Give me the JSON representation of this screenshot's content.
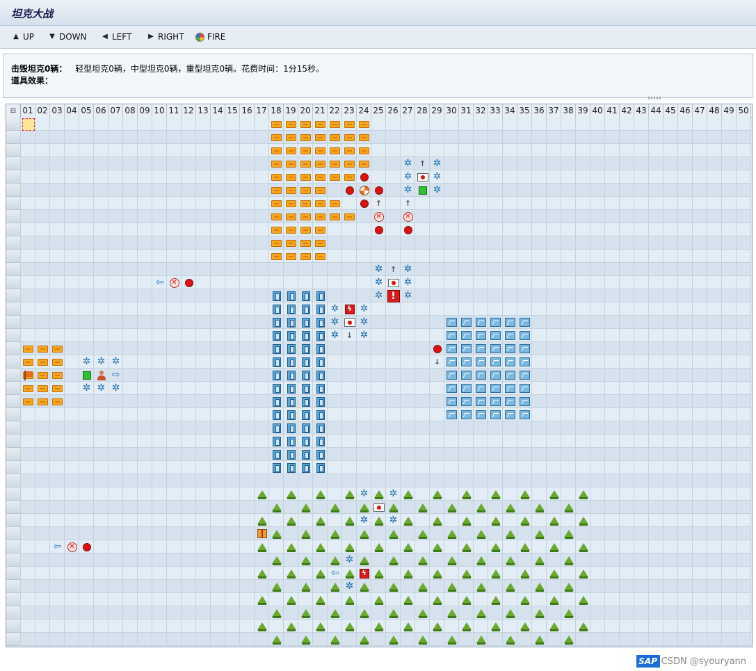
{
  "window": {
    "title": "坦克大战"
  },
  "toolbar": {
    "buttons": [
      {
        "label": "UP",
        "icon": "up-triangle-icon"
      },
      {
        "label": "DOWN",
        "icon": "down-triangle-icon"
      },
      {
        "label": "LEFT",
        "icon": "left-triangle-icon"
      },
      {
        "label": "RIGHT",
        "icon": "right-triangle-icon"
      },
      {
        "label": "FIRE",
        "icon": "fire-ball-icon"
      }
    ]
  },
  "info": {
    "destroyed_label": "击毁坦克0辆：",
    "destroyed_detail": "轻型坦克0辆，中型坦克0辆，重型坦克0辆。花费时间：1分15秒。",
    "items_label": "道具效果："
  },
  "grid": {
    "select_all_icon": "select-all-icon",
    "columns": [
      "01",
      "02",
      "03",
      "04",
      "05",
      "06",
      "07",
      "08",
      "09",
      "10",
      "11",
      "12",
      "13",
      "14",
      "15",
      "16",
      "17",
      "18",
      "19",
      "20",
      "21",
      "22",
      "23",
      "24",
      "25",
      "26",
      "27",
      "28",
      "29",
      "30",
      "31",
      "32",
      "33",
      "34",
      "35",
      "36",
      "37",
      "38",
      "39",
      "40",
      "41",
      "42",
      "43",
      "44",
      "45",
      "46",
      "47",
      "48",
      "49",
      "50"
    ],
    "row_count": 40
  },
  "legend": {
    "brick": "brick-wall-icon",
    "steel": "steel-wall-icon",
    "water": "water-tile-icon",
    "tree": "forest-icon",
    "gear": "enemy-tank-track-icon",
    "player": "player-tank-icon"
  },
  "watermark": {
    "logo": "SAP",
    "text": "CSDN @syouryann"
  }
}
